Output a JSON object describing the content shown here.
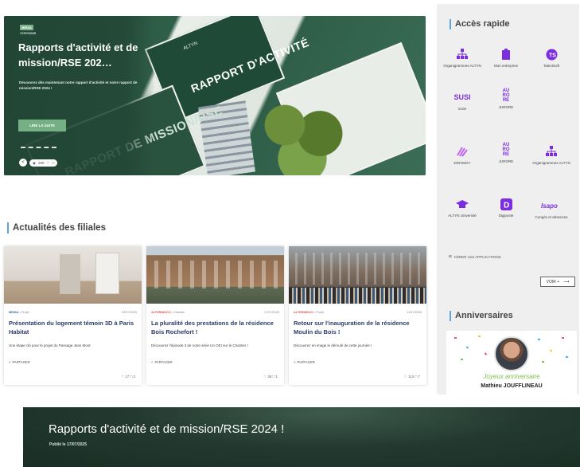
{
  "hero": {
    "tag": "MEDIA",
    "date": "17/07/2025",
    "title": "Rapports d'activité et de mission/RSE 202…",
    "description": "Découvrez dès maintenant notre rapport d'activité et notre rapport de mission/RSE 2024 !",
    "button": "LIRE LA SUITE",
    "image_text_1": "RAPPORT D'ACTIVITÉ",
    "image_text_2": "RAPPORT DE MISSION/RSE",
    "image_logo": "ALTYN",
    "views": "299",
    "share_icon": "share-icon"
  },
  "quick_access": {
    "title": "Accès rapide",
    "apps": [
      {
        "label": "Organigrammes ALTYN",
        "icon": "org-chart-icon"
      },
      {
        "label": "Mon entreprise",
        "icon": "building-icon"
      },
      {
        "label": "TalentSoft",
        "icon": "talentsoft-icon"
      },
      {
        "label": "SUSI",
        "icon": "susi-icon"
      },
      {
        "label": "JURORE",
        "icon": "aurore-icon"
      },
      {
        "label": "DRIVMOY",
        "icon": "drive-icon"
      },
      {
        "label": "JURORE",
        "icon": "aurore-icon"
      },
      {
        "label": "Organigrammes ALTYN",
        "icon": "org-chart-icon"
      },
      {
        "label": "ALTYN Université",
        "icon": "graduation-cap-icon"
      },
      {
        "label": "Digiposte",
        "icon": "digiposte-icon"
      },
      {
        "label": "Congés et absences",
        "icon": "conges-icon"
      }
    ],
    "see_all": "CÉRER LES APPLICATIONS",
    "voir_button": "VOIR +"
  },
  "anniversaires": {
    "title": "Anniversaires",
    "message": "Joyeux anniversaire",
    "name": "Mathieu JOUFFLINEAU"
  },
  "actualites": {
    "title": "Actualités des filiales",
    "items": [
      {
        "category": "MEDIA",
        "sub": "Projet",
        "date": "02/07/2025",
        "title": "Présentation du logement témoin 3D à Paris Habitat",
        "desc": "Une étape clé pour le projet du Passage Jean Moot",
        "share": "PARTAGER",
        "likes": "17",
        "comments": "2"
      },
      {
        "category": "ALTERNIDCO",
        "sub": "Chantier",
        "date": "17/07/2025",
        "title": "La pluralité des prestations de la résidence Bois Rochefort !",
        "desc": "Découvrez l'épisode 3 de notre série Un OEI sur le Chantier !",
        "share": "PARTAGER",
        "likes": "38",
        "comments": "1"
      },
      {
        "category": "ALTERNIDCO",
        "sub": "Projet",
        "date": "11/07/2025",
        "title": "Retour sur l'inauguration de la résidence Moulin du Bois !",
        "desc": "Découvrez en image le déroulé de cette journée !",
        "share": "PARTAGER",
        "likes": "113",
        "comments": "7"
      }
    ]
  },
  "banner": {
    "title": "Rapports d'activité et de mission/RSE 2024 !",
    "published": "Publié le 17/07/2025"
  },
  "colors": {
    "hero_green": "#2c5a45",
    "accent_purple": "#7b2ee0",
    "title_blue": "#2c3b6a",
    "section_bar": "#62a3d7"
  }
}
